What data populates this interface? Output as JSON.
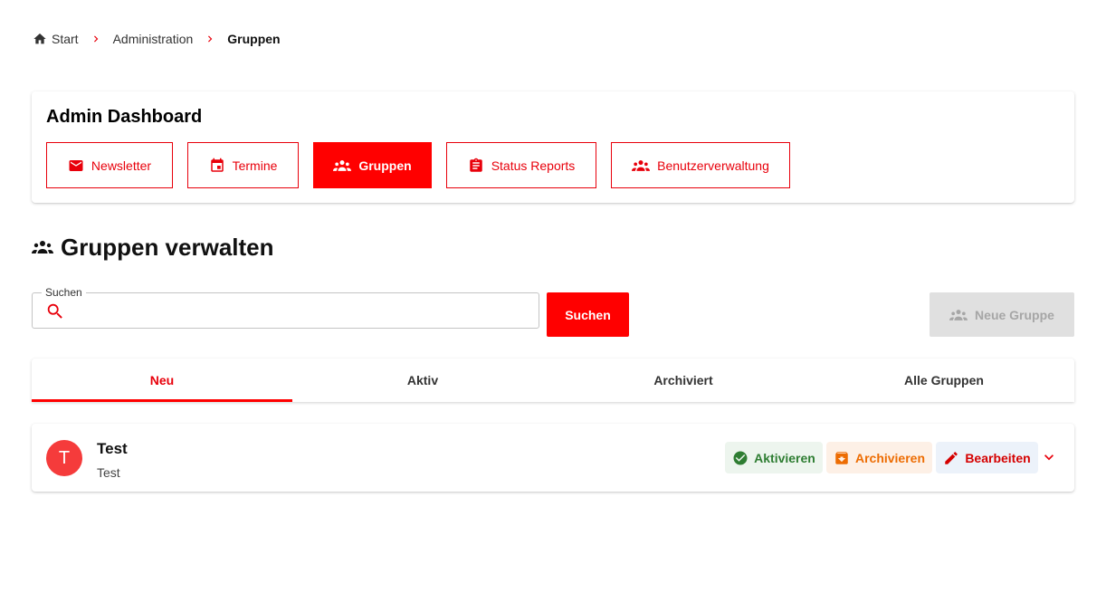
{
  "breadcrumb": {
    "home": "Start",
    "section": "Administration",
    "current": "Gruppen"
  },
  "dashboard": {
    "title": "Admin Dashboard",
    "nav": [
      {
        "label": "Newsletter",
        "icon": "mail-icon"
      },
      {
        "label": "Termine",
        "icon": "calendar-icon"
      },
      {
        "label": "Gruppen",
        "icon": "groups-icon",
        "active": true
      },
      {
        "label": "Status Reports",
        "icon": "clipboard-icon"
      },
      {
        "label": "Benutzerverwaltung",
        "icon": "groups-icon"
      }
    ]
  },
  "page": {
    "title": "Gruppen verwalten"
  },
  "search": {
    "label": "Suchen",
    "value": "",
    "button": "Suchen"
  },
  "new_group": {
    "label": "Neue Gruppe",
    "disabled": true
  },
  "tabs": [
    {
      "label": "Neu",
      "active": true
    },
    {
      "label": "Aktiv"
    },
    {
      "label": "Archiviert"
    },
    {
      "label": "Alle Gruppen"
    }
  ],
  "groups": [
    {
      "avatar_letter": "T",
      "name": "Test",
      "description": "Test",
      "actions": {
        "activate": "Aktivieren",
        "archive": "Archivieren",
        "edit": "Bearbeiten"
      }
    }
  ],
  "colors": {
    "brand": "#ff0000",
    "brand_text": "#e8000b",
    "success": "#2e7d32",
    "warning": "#ed6c02",
    "avatar": "#f53b3b",
    "disabled_bg": "#e0e0e0",
    "disabled_text": "#a6a6a6"
  }
}
